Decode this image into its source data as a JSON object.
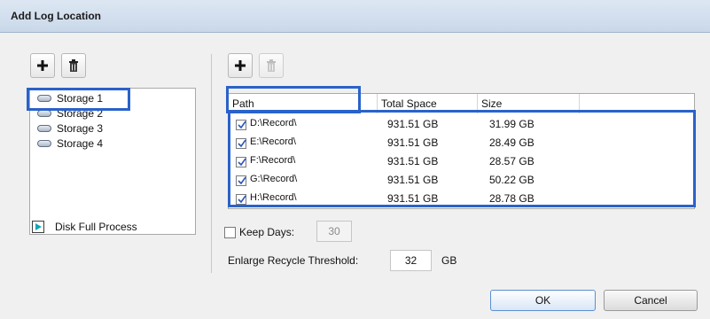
{
  "window": {
    "title": "Add Log Location"
  },
  "left_toolbar": {
    "add_icon": "plus-icon",
    "delete_icon": "trash-icon"
  },
  "right_toolbar": {
    "add_icon": "plus-icon",
    "delete_icon": "trash-icon-disabled"
  },
  "storage_list": [
    {
      "label": "Storage 1",
      "selected": true
    },
    {
      "label": "Storage 2",
      "selected": false
    },
    {
      "label": "Storage 3",
      "selected": false
    },
    {
      "label": "Storage 4",
      "selected": false
    }
  ],
  "disk_full_process": {
    "label": "Disk Full Process",
    "icon": "play-icon"
  },
  "table": {
    "headers": [
      "Path",
      "Total Space",
      "Size"
    ],
    "rows": [
      {
        "checked": true,
        "path": "D:\\Record\\",
        "total": "931.51 GB",
        "size": "31.99 GB"
      },
      {
        "checked": true,
        "path": "E:\\Record\\",
        "total": "931.51 GB",
        "size": "28.49 GB"
      },
      {
        "checked": true,
        "path": "F:\\Record\\",
        "total": "931.51 GB",
        "size": "28.57 GB"
      },
      {
        "checked": true,
        "path": "G:\\Record\\",
        "total": "931.51 GB",
        "size": "50.22 GB"
      },
      {
        "checked": true,
        "path": "H:\\Record\\",
        "total": "931.51 GB",
        "size": "28.78 GB"
      }
    ]
  },
  "keep_days": {
    "label": "Keep Days:",
    "value": "30",
    "checked": false
  },
  "enlarge_recycle": {
    "label": "Enlarge Recycle Threshold:",
    "value": "32",
    "unit": "GB"
  },
  "buttons": {
    "ok": "OK",
    "cancel": "Cancel"
  },
  "colors": {
    "highlight": "#2a62c9",
    "accent": "#12a7b4"
  }
}
